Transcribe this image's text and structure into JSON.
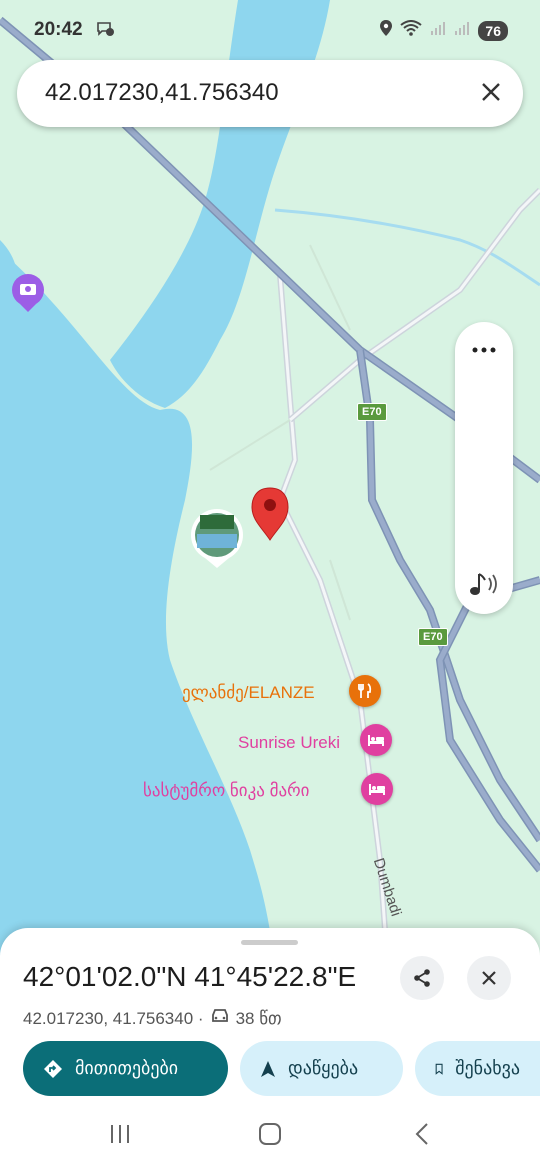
{
  "status_bar": {
    "time": "20:42",
    "battery": "76"
  },
  "search": {
    "query": "42.017230,41.756340"
  },
  "map": {
    "road_shields": [
      "E70",
      "E70"
    ],
    "street_name": "Dumbadi",
    "pois": [
      {
        "name": "ელანძე/ELANZE",
        "color": "#e8710a",
        "icon": "restaurant-icon"
      },
      {
        "name": "Sunrise Ureki",
        "color": "#e040a0",
        "icon": "hotel-icon"
      },
      {
        "name": "სასტუმრო ნიკა მარი",
        "color": "#e040a0",
        "icon": "hotel-icon"
      }
    ]
  },
  "sheet": {
    "title": "42°01'02.0\"N 41°45'22.8\"E",
    "coords": "42.017230, 41.756340 ·",
    "drive_time": "38 წთ",
    "directions_label": "მითითებები",
    "start_label": "დაწყება",
    "save_label": "შენახვა"
  },
  "colors": {
    "water": "#8ed6ee",
    "land": "#d8f3e3",
    "highway": "#8a9fc0",
    "accent": "#0b6e78",
    "pin": "#e53935"
  }
}
